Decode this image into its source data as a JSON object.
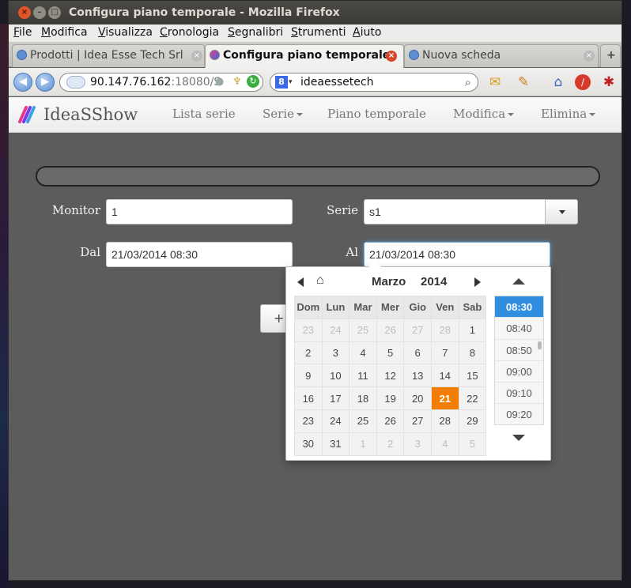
{
  "window": {
    "title": "Configura piano temporale - Mozilla Firefox"
  },
  "menu": [
    "File",
    "Modifica",
    "Visualizza",
    "Cronologia",
    "Segnalibri",
    "Strumenti",
    "Aiuto"
  ],
  "tabs": [
    {
      "label": "Prodotti | Idea Esse Tech Srl",
      "active": false
    },
    {
      "label": "Configura piano temporale",
      "active": true
    },
    {
      "label": "Nuova scheda",
      "active": false
    }
  ],
  "urlbar": {
    "host": "90.147.76.162",
    "rest": ":18080/S"
  },
  "search": {
    "value": "ideaessetech"
  },
  "app": {
    "brand": "IdeaSShow",
    "nav": [
      {
        "label": "Lista serie",
        "dropdown": false
      },
      {
        "label": "Serie",
        "dropdown": true
      },
      {
        "label": "Piano temporale",
        "dropdown": false
      },
      {
        "label": "Modifica",
        "dropdown": true
      },
      {
        "label": "Elimina",
        "dropdown": true
      }
    ]
  },
  "form": {
    "monitor_label": "Monitor",
    "monitor_value": "1",
    "serie_label": "Serie",
    "serie_value": "s1",
    "dal_label": "Dal",
    "dal_value": "21/03/2014 08:30",
    "al_label": "Al",
    "al_value": "21/03/2014 08:30",
    "add_icon": "+"
  },
  "datepicker": {
    "month": "Marzo",
    "year": "2014",
    "weekdays": [
      "Dom",
      "Lun",
      "Mar",
      "Mer",
      "Gio",
      "Ven",
      "Sab"
    ],
    "weeks": [
      [
        [
          "23",
          1
        ],
        [
          "24",
          1
        ],
        [
          "25",
          1
        ],
        [
          "26",
          1
        ],
        [
          "27",
          1
        ],
        [
          "28",
          1
        ],
        [
          "1",
          0
        ]
      ],
      [
        [
          "2",
          0
        ],
        [
          "3",
          0
        ],
        [
          "4",
          0
        ],
        [
          "5",
          0
        ],
        [
          "6",
          0
        ],
        [
          "7",
          0
        ],
        [
          "8",
          0
        ]
      ],
      [
        [
          "9",
          0
        ],
        [
          "10",
          0
        ],
        [
          "11",
          0
        ],
        [
          "12",
          0
        ],
        [
          "13",
          0
        ],
        [
          "14",
          0
        ],
        [
          "15",
          0
        ]
      ],
      [
        [
          "16",
          0
        ],
        [
          "17",
          0
        ],
        [
          "18",
          0
        ],
        [
          "19",
          0
        ],
        [
          "20",
          0
        ],
        [
          "21",
          0
        ],
        [
          "22",
          0
        ]
      ],
      [
        [
          "23",
          0
        ],
        [
          "24",
          0
        ],
        [
          "25",
          0
        ],
        [
          "26",
          0
        ],
        [
          "27",
          0
        ],
        [
          "28",
          0
        ],
        [
          "29",
          0
        ]
      ],
      [
        [
          "30",
          0
        ],
        [
          "31",
          0
        ],
        [
          "1",
          1
        ],
        [
          "2",
          1
        ],
        [
          "3",
          1
        ],
        [
          "4",
          1
        ],
        [
          "5",
          1
        ]
      ]
    ],
    "selected_day": "21",
    "times": [
      "08:30",
      "08:40",
      "08:50",
      "09:00",
      "09:10",
      "09:20"
    ],
    "selected_time": "08:30",
    "accent": "#f27d00",
    "time_accent": "#2f8ee0"
  }
}
